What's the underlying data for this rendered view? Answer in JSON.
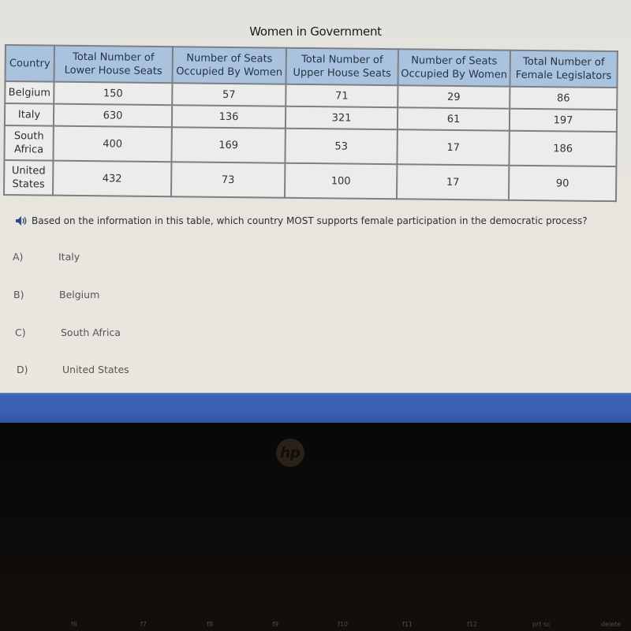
{
  "page": {
    "title": "Women in Government"
  },
  "table": {
    "headers": [
      "Country",
      "Total Number of Lower House Seats",
      "Number of Seats Occupied By Women",
      "Total Number of Upper House Seats",
      "Number of Seats Occupied By Women",
      "Total Number of Female Legislators"
    ],
    "header_lines": [
      [
        "Country"
      ],
      [
        "Total Number of",
        "Lower House Seats"
      ],
      [
        "Number of Seats",
        "Occupied By Women"
      ],
      [
        "Total Number of",
        "Upper House Seats"
      ],
      [
        "Number of Seats",
        "Occupied By Women"
      ],
      [
        "Total Number of",
        "Female Legislators"
      ]
    ],
    "rows": [
      {
        "country": [
          "Belgium"
        ],
        "lower_total": "150",
        "lower_women": "57",
        "upper_total": "71",
        "upper_women": "29",
        "female_total": "86"
      },
      {
        "country": [
          "Italy"
        ],
        "lower_total": "630",
        "lower_women": "136",
        "upper_total": "321",
        "upper_women": "61",
        "female_total": "197"
      },
      {
        "country": [
          "South",
          "Africa"
        ],
        "lower_total": "400",
        "lower_women": "169",
        "upper_total": "53",
        "upper_women": "17",
        "female_total": "186"
      },
      {
        "country": [
          "United",
          "States"
        ],
        "lower_total": "432",
        "lower_women": "73",
        "upper_total": "100",
        "upper_women": "17",
        "female_total": "90"
      }
    ]
  },
  "question": {
    "audio_icon": "speaker-icon",
    "text": "Based on the information in this table, which country MOST supports female participation in the democratic process?",
    "options": [
      {
        "letter": "A)",
        "text": "Italy"
      },
      {
        "letter": "B)",
        "text": "Belgium"
      },
      {
        "letter": "C)",
        "text": "South Africa"
      },
      {
        "letter": "D)",
        "text": "United States"
      }
    ]
  },
  "device": {
    "logo": "hp",
    "function_keys": [
      "f6",
      "f7",
      "f8",
      "f9",
      "f10",
      "f11",
      "f12",
      "prt sc",
      "delete"
    ]
  },
  "colors": {
    "header_bg": "#a9c3de",
    "cell_bg": "#ececea",
    "border": "#7c7f85",
    "taskbar": "#3a5fb3"
  }
}
